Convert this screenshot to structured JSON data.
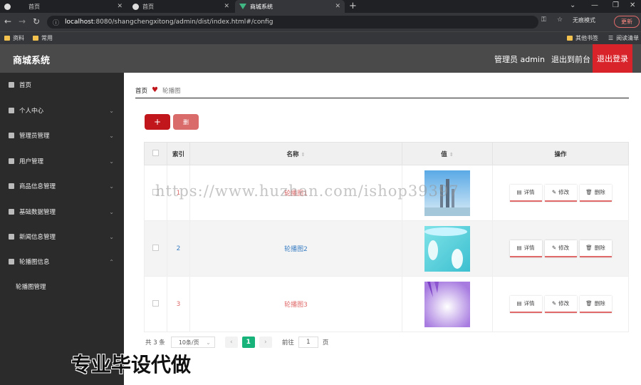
{
  "browser": {
    "tabs": [
      {
        "label": "首页"
      },
      {
        "label": "首页"
      },
      {
        "label": "商城系统"
      }
    ],
    "url_host": "localhost",
    "url_rest": ":8080/shangchengxitong/admin/dist/index.html#/config",
    "incognito": "无痕模式",
    "update": "更新",
    "bookmarks": [
      "资料",
      "常用"
    ],
    "bookmarks_right": [
      "其他书签",
      "阅读清单"
    ]
  },
  "header": {
    "brand": "商城系统",
    "user": "管理员 admin",
    "back": "退出到前台",
    "logout": "退出登录"
  },
  "sidebar": {
    "items": [
      {
        "label": "首页"
      },
      {
        "label": "个人中心"
      },
      {
        "label": "管理员管理"
      },
      {
        "label": "用户管理"
      },
      {
        "label": "商品信息管理"
      },
      {
        "label": "基础数据管理"
      },
      {
        "label": "新闻信息管理"
      },
      {
        "label": "轮播图信息"
      }
    ],
    "sub_item": "轮播图管理"
  },
  "breadcrumb": {
    "home": "首页",
    "current": "轮播图"
  },
  "toolbar": {
    "add": "+",
    "delete": "删"
  },
  "table": {
    "headers": {
      "index": "索引",
      "name": "名称",
      "value": "值",
      "ops": "操作"
    },
    "rows": [
      {
        "index": "1",
        "name": "轮播图1"
      },
      {
        "index": "2",
        "name": "轮播图2"
      },
      {
        "index": "3",
        "name": "轮播图3"
      }
    ],
    "ops": {
      "detail": "详情",
      "edit": "修改",
      "delete": "删除"
    }
  },
  "pager": {
    "total": "共 3 条",
    "size": "10条/页",
    "current": "1",
    "goto_label": "前往",
    "goto_value": "1",
    "page_suffix": "页"
  },
  "watermark": "https://www.huzhan.com/ishop39397",
  "overlay_text": "专业毕设代做"
}
